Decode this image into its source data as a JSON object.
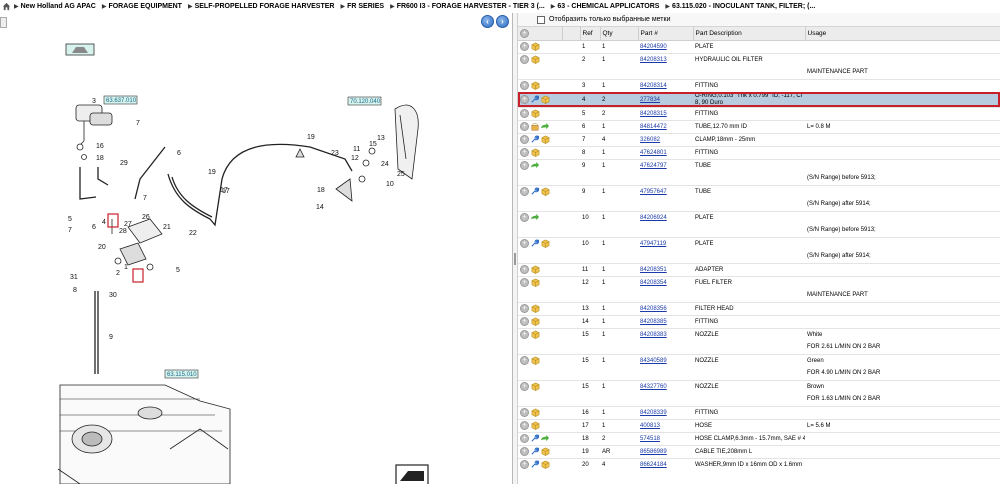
{
  "breadcrumb": [
    "New Holland AG APAC",
    "FORAGE EQUIPMENT",
    "SELF-PROPELLED FORAGE HARVESTER",
    "FR SERIES",
    "FR600 I3 - FORAGE HARVESTER - TIER 3 (...",
    "63 - CHEMICAL APPLICATORS",
    "63.115.020 - INOCULANT TANK, FILTER; (..."
  ],
  "filter": {
    "label": "Отобразить только выбранные метки"
  },
  "table": {
    "headers": [
      "Ref",
      "Qty",
      "Part #",
      "Part Description",
      "Usage"
    ],
    "rows": [
      {
        "ref": "1",
        "qty": "1",
        "part": "84204590",
        "desc": "PLATE",
        "usage": "",
        "icons": [
          "cube"
        ]
      },
      {
        "ref": "2",
        "qty": "1",
        "part": "84208313",
        "desc": "HYDRAULIC OIL FILTER",
        "usage": "",
        "icons": [
          "cube"
        ]
      },
      {
        "note": "MAINTENANCE PART"
      },
      {
        "ref": "3",
        "qty": "1",
        "part": "84208314",
        "desc": "FITTING",
        "usage": "",
        "icons": [
          "cube"
        ]
      },
      {
        "ref": "4",
        "qty": "2",
        "part": "277834",
        "desc": "O-RING,0.103\" Thk x 0.799\" ID, -117, Cl 8, 90 Duro",
        "usage": "",
        "icons": [
          "wrench",
          "cube"
        ],
        "selected": true
      },
      {
        "ref": "5",
        "qty": "2",
        "part": "84208315",
        "desc": "FITTING",
        "usage": "",
        "icons": [
          "cube"
        ]
      },
      {
        "ref": "6",
        "qty": "1",
        "part": "84814472",
        "desc": "TUBE,12.70 mm ID",
        "usage": "L= 0.8 M",
        "icons": [
          "box",
          "arrow"
        ]
      },
      {
        "ref": "7",
        "qty": "4",
        "part": "326082",
        "desc": "CLAMP,18mm - 25mm",
        "usage": "",
        "icons": [
          "wrench",
          "cube"
        ]
      },
      {
        "ref": "8",
        "qty": "1",
        "part": "47624801",
        "desc": "FITTING",
        "usage": "",
        "icons": [
          "cube"
        ]
      },
      {
        "ref": "9",
        "qty": "1",
        "part": "47624797",
        "desc": "TUBE",
        "usage": "",
        "icons": [
          "arrow"
        ]
      },
      {
        "note": "(S/N Range) before 5913;"
      },
      {
        "ref": "9",
        "qty": "1",
        "part": "47957647",
        "desc": "TUBE",
        "usage": "",
        "icons": [
          "wrench",
          "cube"
        ]
      },
      {
        "note": "(S/N Range) after 5914;"
      },
      {
        "ref": "10",
        "qty": "1",
        "part": "84206924",
        "desc": "PLATE",
        "usage": "",
        "icons": [
          "arrow"
        ]
      },
      {
        "note": "(S/N Range) before 5913;"
      },
      {
        "ref": "10",
        "qty": "1",
        "part": "47947119",
        "desc": "PLATE",
        "usage": "",
        "icons": [
          "wrench",
          "cube"
        ]
      },
      {
        "note": "(S/N Range) after 5914;"
      },
      {
        "ref": "11",
        "qty": "1",
        "part": "84208351",
        "desc": "ADAPTER",
        "usage": "",
        "icons": [
          "cube"
        ]
      },
      {
        "ref": "12",
        "qty": "1",
        "part": "84208354",
        "desc": "FUEL FILTER",
        "usage": "",
        "icons": [
          "cube"
        ]
      },
      {
        "note": "MAINTENANCE PART"
      },
      {
        "ref": "13",
        "qty": "1",
        "part": "84208356",
        "desc": "FILTER HEAD",
        "usage": "",
        "icons": [
          "cube"
        ]
      },
      {
        "ref": "14",
        "qty": "1",
        "part": "84208385",
        "desc": "FITTING",
        "usage": "",
        "icons": [
          "cube"
        ]
      },
      {
        "ref": "15",
        "qty": "1",
        "part": "84208383",
        "desc": "NOZZLE",
        "usage": "White",
        "icons": [
          "cube"
        ]
      },
      {
        "note": "FOR 2.61 L/MIN ON 2 BAR"
      },
      {
        "ref": "15",
        "qty": "1",
        "part": "84340589",
        "desc": "NOZZLE",
        "usage": "Green",
        "icons": [
          "cube"
        ]
      },
      {
        "note": "FOR 4.90 L/MIN ON 2 BAR"
      },
      {
        "ref": "15",
        "qty": "1",
        "part": "84327760",
        "desc": "NOZZLE",
        "usage": "Brown",
        "icons": [
          "cube"
        ]
      },
      {
        "note": "FOR 1.63 L/MIN ON 2 BAR"
      },
      {
        "ref": "16",
        "qty": "1",
        "part": "84208339",
        "desc": "FITTING",
        "usage": "",
        "icons": [
          "cube"
        ]
      },
      {
        "ref": "17",
        "qty": "1",
        "part": "400813",
        "desc": "HOSE",
        "usage": "L= 5.6 M",
        "icons": [
          "cube"
        ]
      },
      {
        "ref": "18",
        "qty": "2",
        "part": "574518",
        "desc": "HOSE CLAMP,6.3mm - 15.7mm, SAE # 4",
        "usage": "",
        "icons": [
          "wrench",
          "arrow"
        ]
      },
      {
        "ref": "19",
        "qty": "AR",
        "part": "86586989",
        "desc": "CABLE TIE,208mm L",
        "usage": "",
        "icons": [
          "wrench",
          "cube"
        ]
      },
      {
        "ref": "20",
        "qty": "4",
        "part": "86624184",
        "desc": "WASHER,9mm ID x 16mm OD x 1.6mm",
        "usage": "",
        "icons": [
          "wrench",
          "cube"
        ]
      }
    ]
  },
  "drawing": {
    "refs": [
      "63.637.010",
      "70.120.040",
      "63.115.010"
    ],
    "callouts": [
      "3",
      "7",
      "17",
      "18",
      "16",
      "6",
      "19",
      "17",
      "23",
      "11",
      "12",
      "15",
      "13",
      "24",
      "25",
      "10",
      "14",
      "18",
      "5",
      "4",
      "7",
      "20",
      "26",
      "28",
      "27",
      "21",
      "22",
      "6",
      "2",
      "1",
      "5",
      "31",
      "8",
      "30",
      "9",
      "29",
      "7",
      "19"
    ]
  },
  "colors": {
    "accent": "#c8202a",
    "link": "#1a3aa9",
    "selected": "#b7ccde",
    "ref_box": "#d7f3ee"
  }
}
